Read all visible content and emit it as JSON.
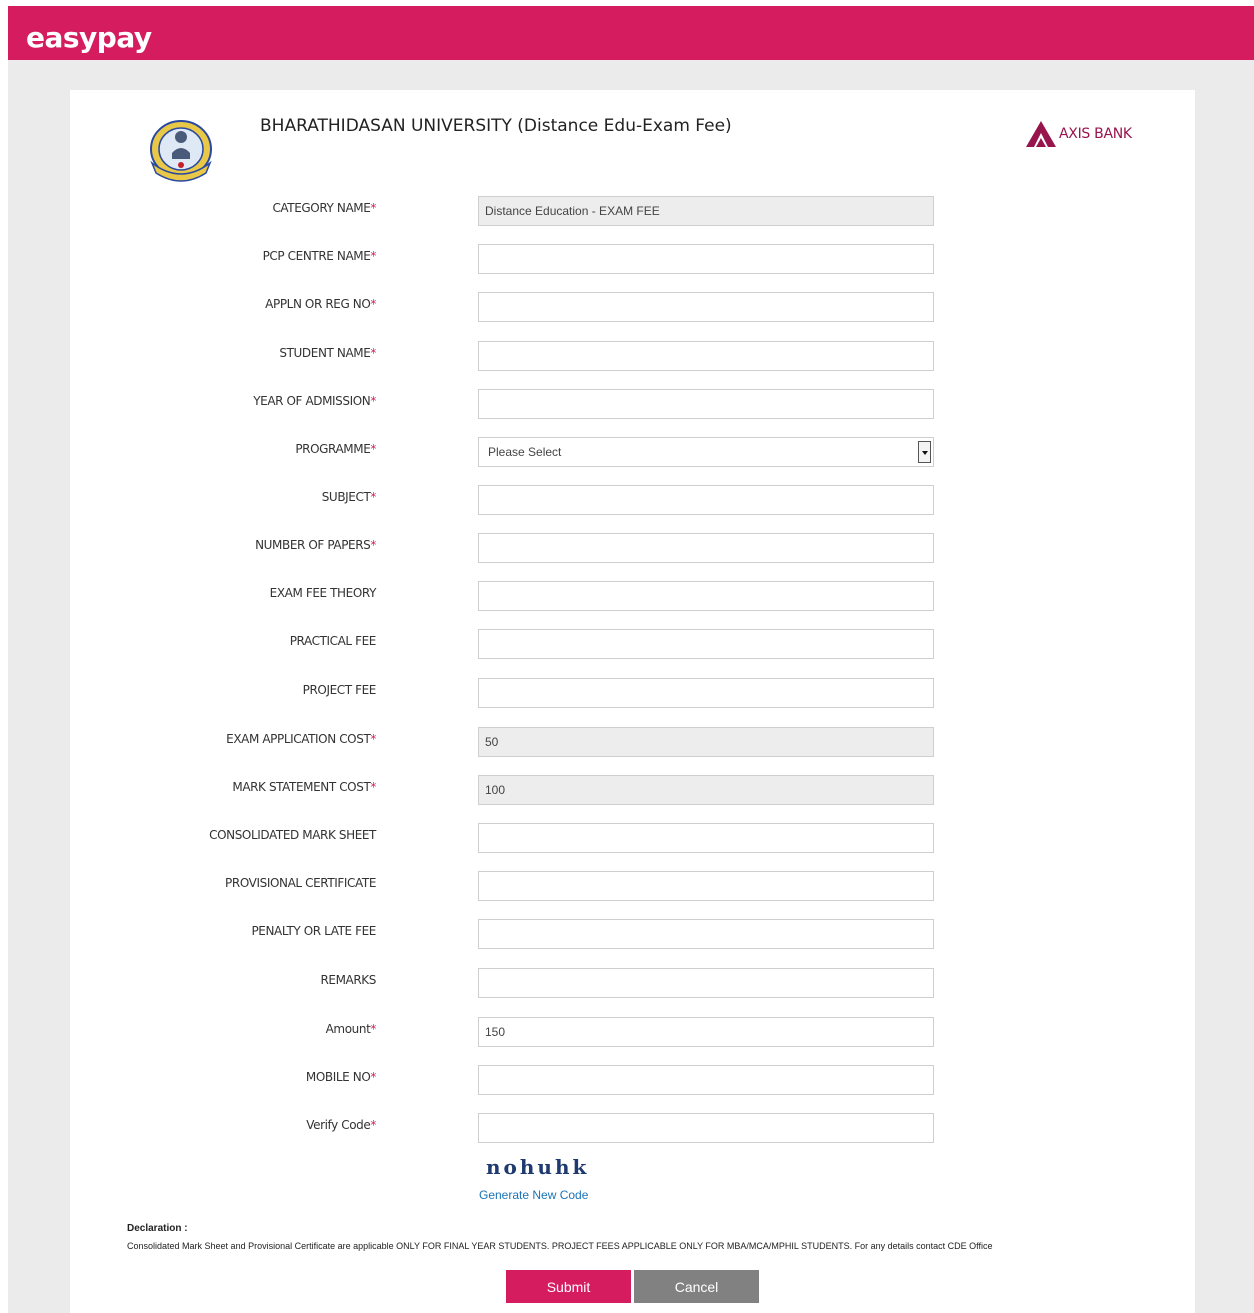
{
  "header": {
    "brand": "easypay",
    "brand_color": "#d41c5e"
  },
  "org": {
    "title": "BHARATHIDASAN UNIVERSITY (Distance Edu-Exam Fee)",
    "bank_name": "AXIS BANK",
    "bank_color": "#97144d"
  },
  "form": {
    "fields": [
      {
        "label": "CATEGORY NAME",
        "required": true,
        "value": "Distance Education - EXAM FEE",
        "readonly": true
      },
      {
        "label": "PCP CENTRE NAME",
        "required": true,
        "value": ""
      },
      {
        "label": "APPLN OR REG NO",
        "required": true,
        "value": ""
      },
      {
        "label": "STUDENT NAME",
        "required": true,
        "value": ""
      },
      {
        "label": "YEAR OF ADMISSION",
        "required": true,
        "value": ""
      },
      {
        "label": "PROGRAMME",
        "required": true,
        "value": "Please Select",
        "type": "select"
      },
      {
        "label": "SUBJECT",
        "required": true,
        "value": ""
      },
      {
        "label": "NUMBER OF PAPERS",
        "required": true,
        "value": ""
      },
      {
        "label": "EXAM FEE THEORY",
        "required": false,
        "value": ""
      },
      {
        "label": "PRACTICAL FEE",
        "required": false,
        "value": ""
      },
      {
        "label": "PROJECT FEE",
        "required": false,
        "value": ""
      },
      {
        "label": "EXAM APPLICATION COST",
        "required": true,
        "value": "50",
        "readonly": true
      },
      {
        "label": "MARK STATEMENT COST",
        "required": true,
        "value": "100",
        "readonly": true
      },
      {
        "label": "CONSOLIDATED MARK SHEET",
        "required": false,
        "value": ""
      },
      {
        "label": "PROVISIONAL CERTIFICATE",
        "required": false,
        "value": ""
      },
      {
        "label": "PENALTY OR LATE FEE",
        "required": false,
        "value": ""
      },
      {
        "label": "REMARKS",
        "required": false,
        "value": ""
      },
      {
        "label": "Amount",
        "required": true,
        "value": "150"
      },
      {
        "label": "MOBILE NO",
        "required": true,
        "value": ""
      },
      {
        "label": "Verify Code",
        "required": true,
        "value": ""
      }
    ],
    "required_marker": "*",
    "captcha_text": "nohuhk",
    "generate_code_label": "Generate New Code"
  },
  "declaration": {
    "title": "Declaration :",
    "text": "Consolidated Mark Sheet and Provisional Certificate are applicable ONLY FOR FINAL YEAR STUDENTS. PROJECT FEES APPLICABLE ONLY FOR MBA/MCA/MPHIL STUDENTS. For any details contact CDE Office"
  },
  "actions": {
    "submit_label": "Submit",
    "cancel_label": "Cancel"
  }
}
